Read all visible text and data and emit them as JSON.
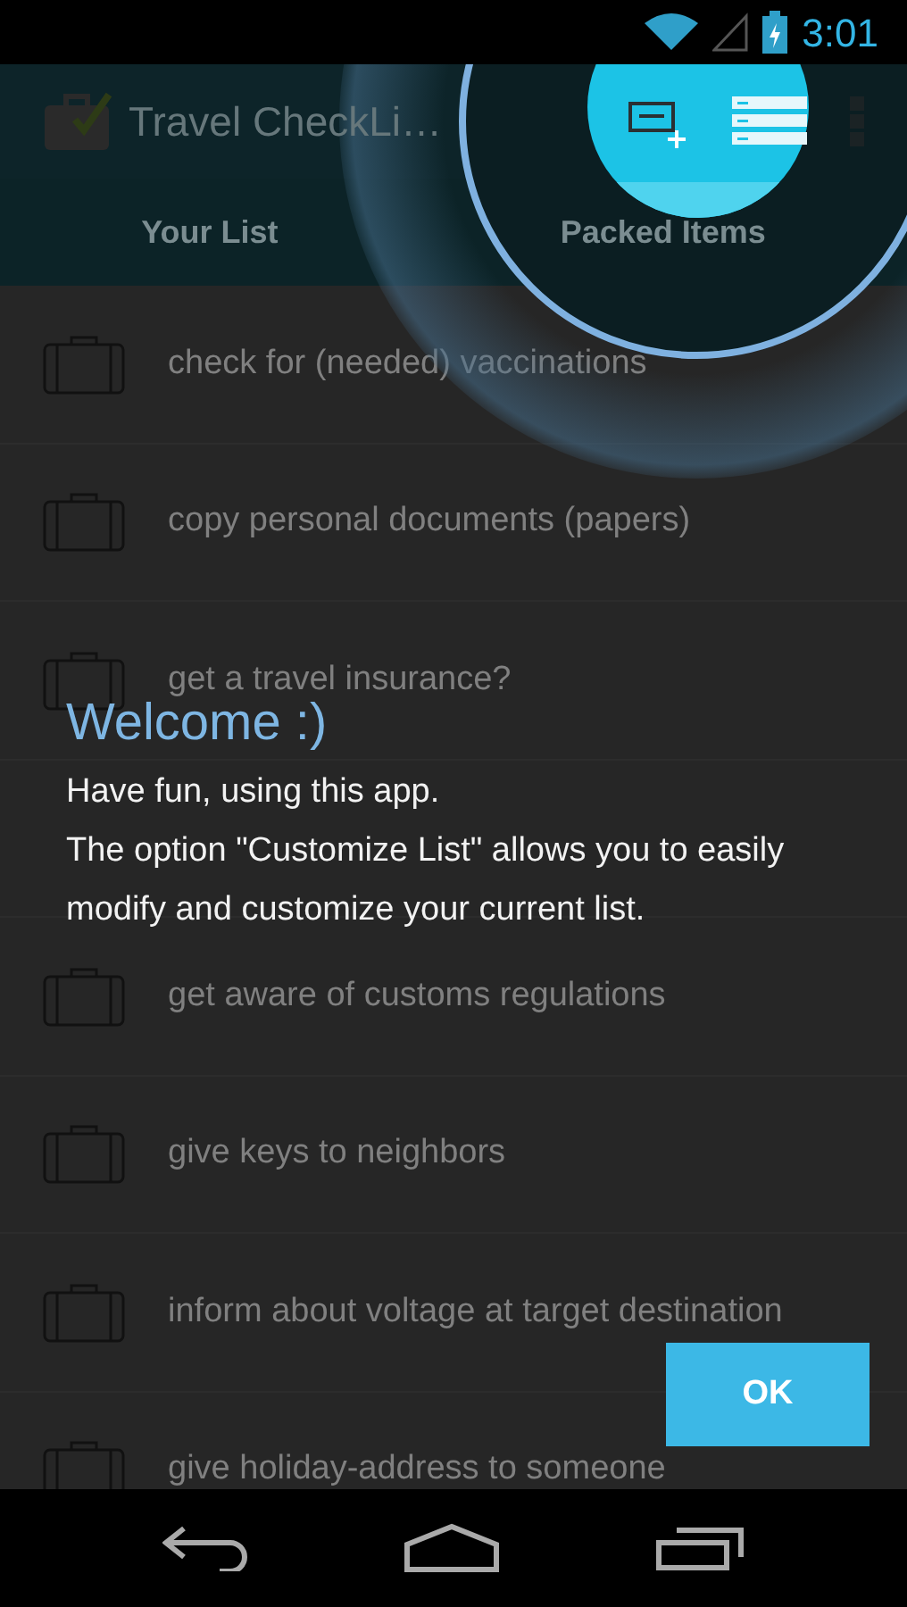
{
  "status_bar": {
    "time": "3:01"
  },
  "action_bar": {
    "title": "Travel CheckLi…"
  },
  "tabs": [
    {
      "label": "Your List"
    },
    {
      "label": "Packed Items"
    }
  ],
  "items": [
    {
      "label": "check for (needed) vaccinations"
    },
    {
      "label": "copy personal documents (papers)"
    },
    {
      "label": "get a travel insurance?"
    },
    {
      "kind": "covered"
    },
    {
      "label": "get aware of customs regulations"
    },
    {
      "label": "give keys to neighbors"
    },
    {
      "label": "inform about voltage at target destination"
    },
    {
      "label": "give holiday-address to someone"
    }
  ],
  "dialog": {
    "title": "Welcome :)",
    "paragraphs": [
      "Have fun, using this app.",
      "The option \"Customize List\" allows you to easily modify and customize your current list."
    ],
    "button": "OK"
  }
}
